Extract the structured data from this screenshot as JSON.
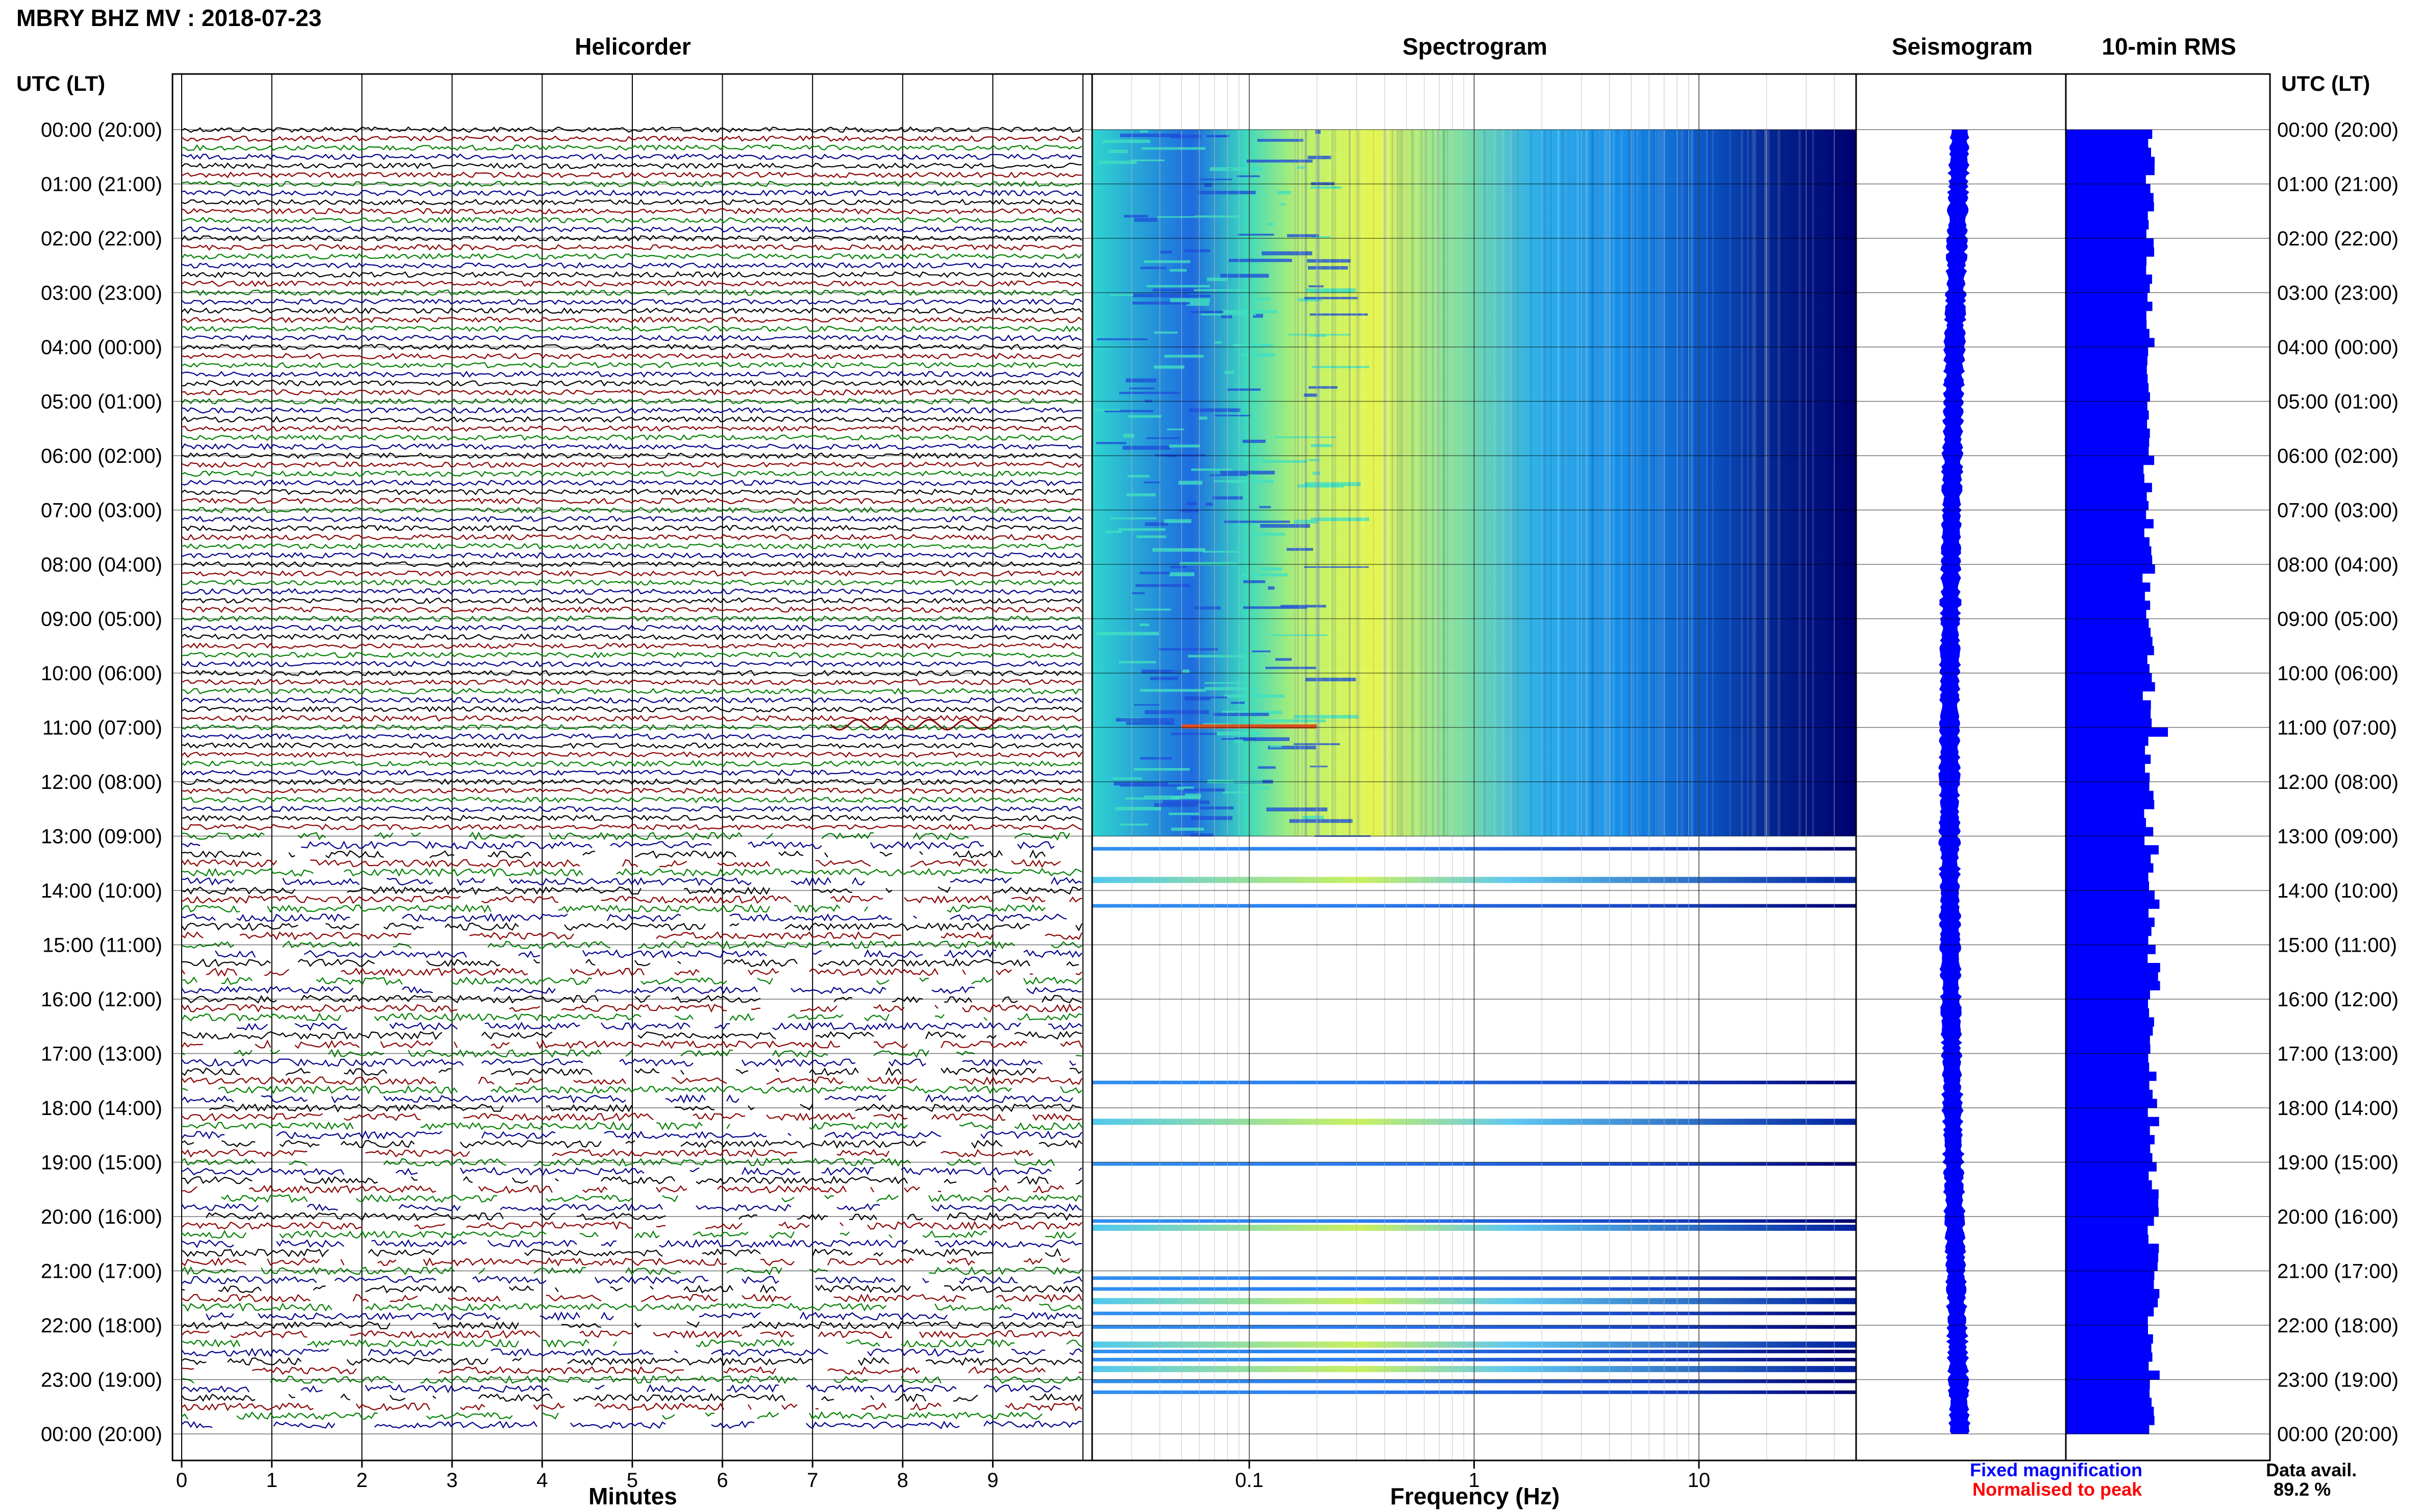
{
  "header": {
    "title": "MBRY BHZ MV : 2018-07-23",
    "utc_left_label": "UTC (LT)",
    "utc_right_label": "UTC (LT)"
  },
  "panels": {
    "helicorder_title": "Helicorder",
    "spectrogram_title": "Spectrogram",
    "seismogram_title": "Seismogram",
    "rms_title": "10-min RMS"
  },
  "x_axes": {
    "helicorder_xlabel": "Minutes",
    "spectrogram_xlabel": "Frequency (Hz)"
  },
  "legend": {
    "fixed_magnification": "Fixed magnification",
    "normalised_to_peak": "Normalised to peak",
    "fixed_color": "#0000ff",
    "normalised_color": "#ff0000"
  },
  "data_availability": {
    "label": "Data avail.",
    "value": "89.2 %"
  },
  "colors": {
    "helicorder_traces": [
      "#000000",
      "#8b0000",
      "#008000",
      "#00008b"
    ],
    "spectrogram_low": "#00007f",
    "spectrogram_mid": "#00bfff",
    "spectrogram_high": "#ffff00",
    "seismogram": "#0000ff",
    "rms": "#0000ff"
  },
  "chart_data": [
    {
      "type": "line",
      "name": "Helicorder",
      "xlabel": "Minutes",
      "x_ticks": [
        "0",
        "1",
        "2",
        "3",
        "4",
        "5",
        "6",
        "7",
        "8",
        "9"
      ],
      "xlim": [
        0,
        10
      ],
      "time_ticks": [
        "00:00 (20:00)",
        "01:00 (21:00)",
        "02:00 (22:00)",
        "03:00 (23:00)",
        "04:00 (00:00)",
        "05:00 (01:00)",
        "06:00 (02:00)",
        "07:00 (03:00)",
        "08:00 (04:00)",
        "09:00 (05:00)",
        "10:00 (06:00)",
        "11:00 (07:00)",
        "12:00 (08:00)",
        "13:00 (09:00)",
        "14:00 (10:00)",
        "15:00 (11:00)",
        "16:00 (12:00)",
        "17:00 (13:00)",
        "18:00 (14:00)",
        "19:00 (15:00)",
        "20:00 (16:00)",
        "21:00 (17:00)",
        "22:00 (18:00)",
        "23:00 (19:00)",
        "00:00 (20:00)"
      ],
      "rows_per_hour": 6,
      "gappy_after_hour": 13
    },
    {
      "type": "heatmap",
      "name": "Spectrogram",
      "xlabel": "Frequency (Hz)",
      "x_scale": "log",
      "xlim": [
        0.02,
        50
      ],
      "x_ticks": [
        "0.1",
        "1",
        "10"
      ],
      "ylim": [
        0,
        24
      ],
      "continuous_until_hour": 13,
      "peak_energy_hz": [
        0.2,
        0.6
      ]
    },
    {
      "type": "line",
      "name": "Seismogram",
      "ylim": [
        0,
        24
      ]
    },
    {
      "type": "bar",
      "name": "10-min RMS",
      "ylim": [
        0,
        24
      ],
      "spike_at_hour": 11
    }
  ]
}
